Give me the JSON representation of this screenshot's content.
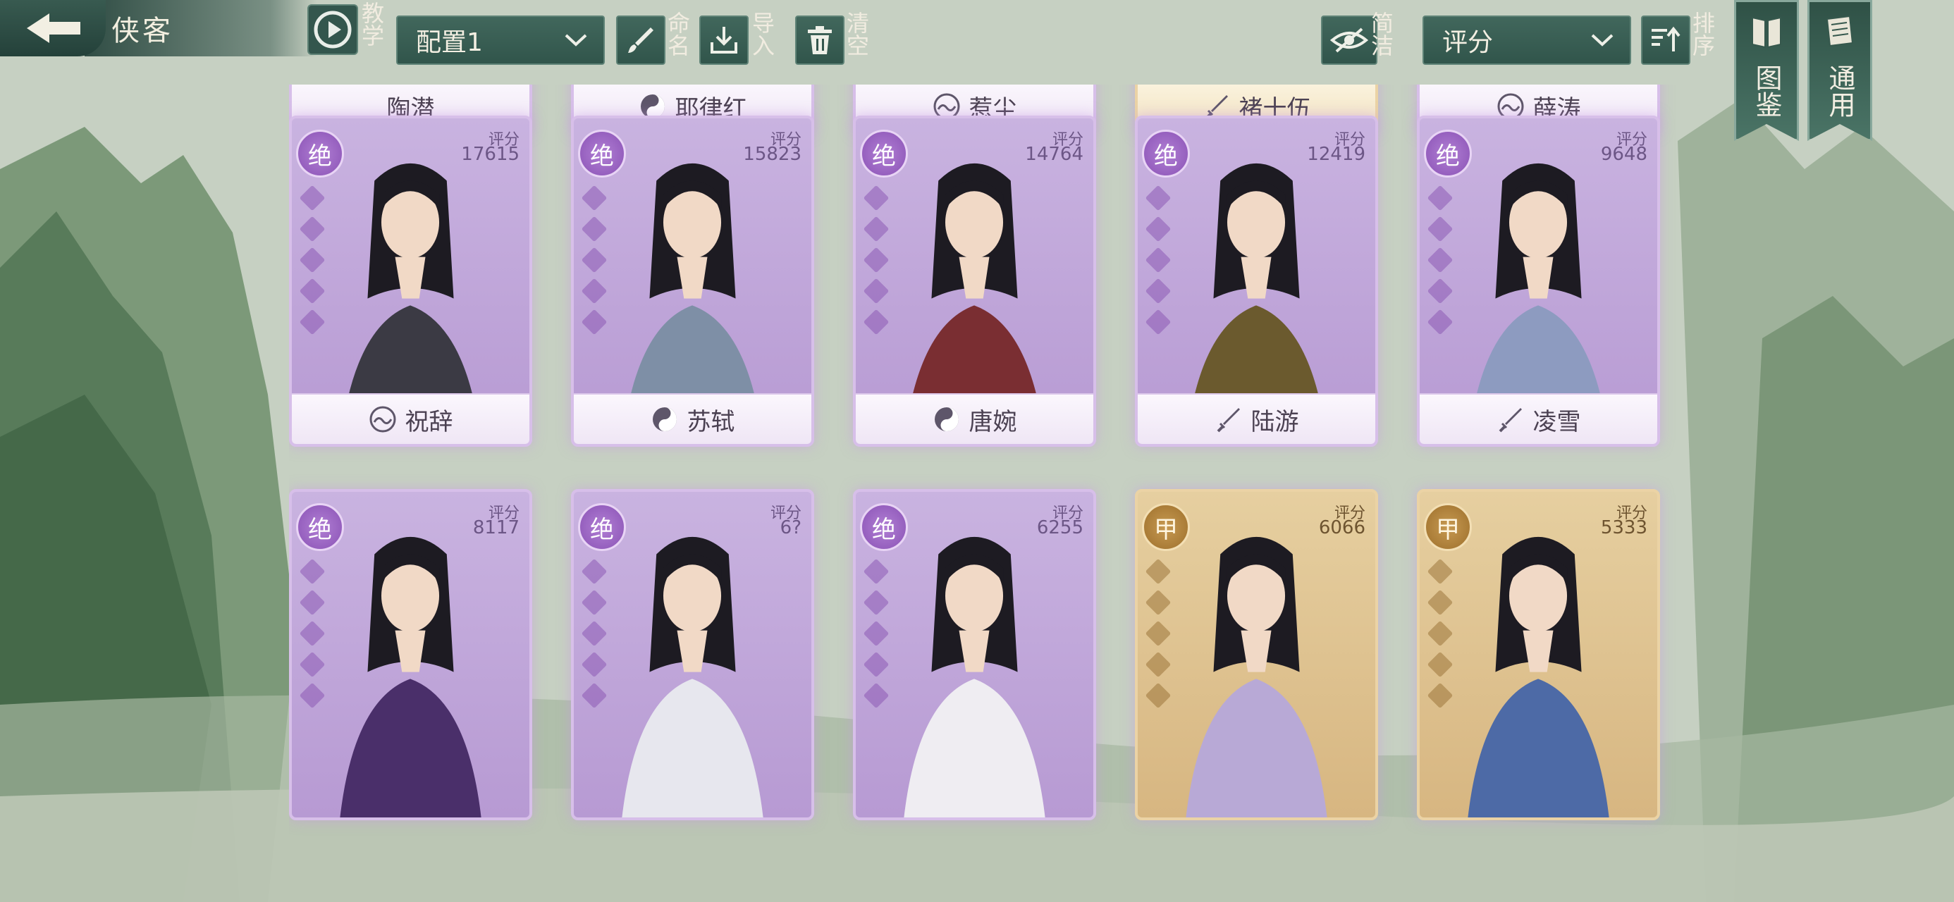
{
  "header": {
    "title": "侠客",
    "tutorial_label": "教学",
    "config_select": "配置1",
    "rename_label": "命名",
    "import_label": "导入",
    "clear_label": "清空",
    "simple_label": "简洁",
    "sort_select": "评分",
    "sort_label": "排序",
    "codex_label": "图鉴",
    "general_label": "通用"
  },
  "colors": {
    "accent": "#33564d",
    "purple_rarity": "#b79ad3",
    "gold_rarity": "#d7b681"
  },
  "top_row": [
    {
      "name": "陶潜",
      "icon": "none",
      "rarity": "purple"
    },
    {
      "name": "耶律红",
      "icon": "yin-yang-icon",
      "rarity": "purple"
    },
    {
      "name": "惹尘",
      "icon": "wave-sect-icon",
      "rarity": "purple"
    },
    {
      "name": "褚十伍",
      "icon": "sword-icon",
      "rarity": "gold"
    },
    {
      "name": "薛涛",
      "icon": "wave-sect-icon",
      "rarity": "purple"
    }
  ],
  "cards": [
    {
      "name": "祝辞",
      "score_label": "评分",
      "score": "17615",
      "badge": "绝",
      "rarity": "purple",
      "icon": "wave-sect-icon"
    },
    {
      "name": "苏轼",
      "score_label": "评分",
      "score": "15823",
      "badge": "绝",
      "rarity": "purple",
      "icon": "yin-yang-icon"
    },
    {
      "name": "唐婉",
      "score_label": "评分",
      "score": "14764",
      "badge": "绝",
      "rarity": "purple",
      "icon": "yin-yang-icon"
    },
    {
      "name": "陆游",
      "score_label": "评分",
      "score": "12419",
      "badge": "绝",
      "rarity": "purple",
      "icon": "sword-icon"
    },
    {
      "name": "凌雪",
      "score_label": "评分",
      "score": "9648",
      "badge": "绝",
      "rarity": "purple",
      "icon": "sword-icon"
    },
    {
      "name": "",
      "score_label": "评分",
      "score": "8117",
      "badge": "绝",
      "rarity": "purple",
      "icon": "none"
    },
    {
      "name": "",
      "score_label": "评分",
      "score": "6?",
      "badge": "绝",
      "rarity": "purple",
      "icon": "none"
    },
    {
      "name": "",
      "score_label": "评分",
      "score": "6255",
      "badge": "绝",
      "rarity": "purple",
      "icon": "none"
    },
    {
      "name": "",
      "score_label": "评分",
      "score": "6066",
      "badge": "甲",
      "rarity": "gold",
      "icon": "none"
    },
    {
      "name": "",
      "score_label": "评分",
      "score": "5333",
      "badge": "甲",
      "rarity": "gold",
      "icon": "none"
    }
  ]
}
